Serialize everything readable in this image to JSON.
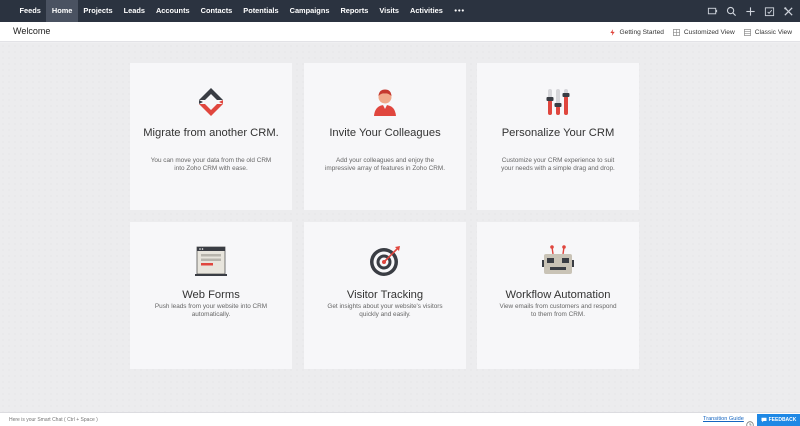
{
  "nav": {
    "items": [
      {
        "label": "Feeds",
        "active": false
      },
      {
        "label": "Home",
        "active": true
      },
      {
        "label": "Projects",
        "active": false
      },
      {
        "label": "Leads",
        "active": false
      },
      {
        "label": "Accounts",
        "active": false
      },
      {
        "label": "Contacts",
        "active": false
      },
      {
        "label": "Potentials",
        "active": false
      },
      {
        "label": "Campaigns",
        "active": false
      },
      {
        "label": "Reports",
        "active": false
      },
      {
        "label": "Visits",
        "active": false
      },
      {
        "label": "Activities",
        "active": false
      }
    ],
    "more_label": "•••",
    "icons": [
      "presentation-icon",
      "search-icon",
      "plus-icon",
      "calendar-icon",
      "tools-icon"
    ]
  },
  "header": {
    "title": "Welcome",
    "getting_started": "Getting Started",
    "customized_view": "Customized View",
    "classic_view": "Classic View"
  },
  "cards": [
    {
      "icon": "migrate-icon",
      "title": "Migrate from another CRM.",
      "desc": "You can move your data from the old CRM into Zoho CRM with ease."
    },
    {
      "icon": "invite-user-icon",
      "title": "Invite Your Colleagues",
      "desc": "Add your colleagues and enjoy the impressive array of features in Zoho CRM."
    },
    {
      "icon": "personalize-sliders-icon",
      "title": "Personalize Your CRM",
      "desc": "Customize your CRM experience to suit your needs with a simple drag and drop."
    },
    {
      "icon": "web-form-icon",
      "title": "Web Forms",
      "desc": "Push leads from your website into CRM automatically."
    },
    {
      "icon": "target-icon",
      "title": "Visitor Tracking",
      "desc": "Get insights about your website's visitors quickly and easily."
    },
    {
      "icon": "robot-icon",
      "title": "Workflow Automation",
      "desc": "View emails from customers and respond to them from CRM."
    }
  ],
  "footer": {
    "smart_chat_placeholder": "Here is your Smart Chat ( Ctrl + Space )",
    "transition_guide": "Transition Guide",
    "feedback": "FEEDBACK"
  },
  "colors": {
    "nav_bg": "#2b3340",
    "accent_red": "#e0463e",
    "link_blue": "#1565c0",
    "feedback_blue": "#1e88e5"
  }
}
